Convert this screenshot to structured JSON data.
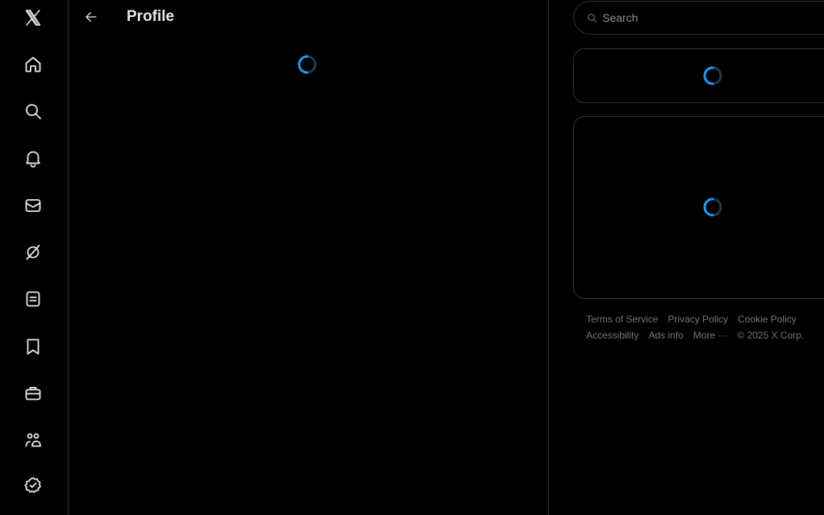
{
  "header": {
    "title": "Profile"
  },
  "nav": {
    "items": [
      {
        "name": "x-logo-icon"
      },
      {
        "name": "home-icon"
      },
      {
        "name": "explore-icon"
      },
      {
        "name": "notifications-icon"
      },
      {
        "name": "messages-icon"
      },
      {
        "name": "grok-icon"
      },
      {
        "name": "lists-icon"
      },
      {
        "name": "bookmarks-icon"
      },
      {
        "name": "jobs-icon"
      },
      {
        "name": "communities-icon"
      },
      {
        "name": "verified-icon"
      }
    ]
  },
  "search": {
    "placeholder": "Search",
    "value": ""
  },
  "footer": {
    "row1": [
      "Terms of Service",
      "Privacy Policy",
      "Cookie Policy"
    ],
    "row2": [
      "Accessibility",
      "Ads info",
      "More ···"
    ],
    "copyright": "© 2025 X Corp."
  },
  "colors": {
    "background": "#000000",
    "border": "#2f3336",
    "text": "#e7e9ea",
    "muted": "#71767b",
    "accent": "#1d9bf0"
  }
}
